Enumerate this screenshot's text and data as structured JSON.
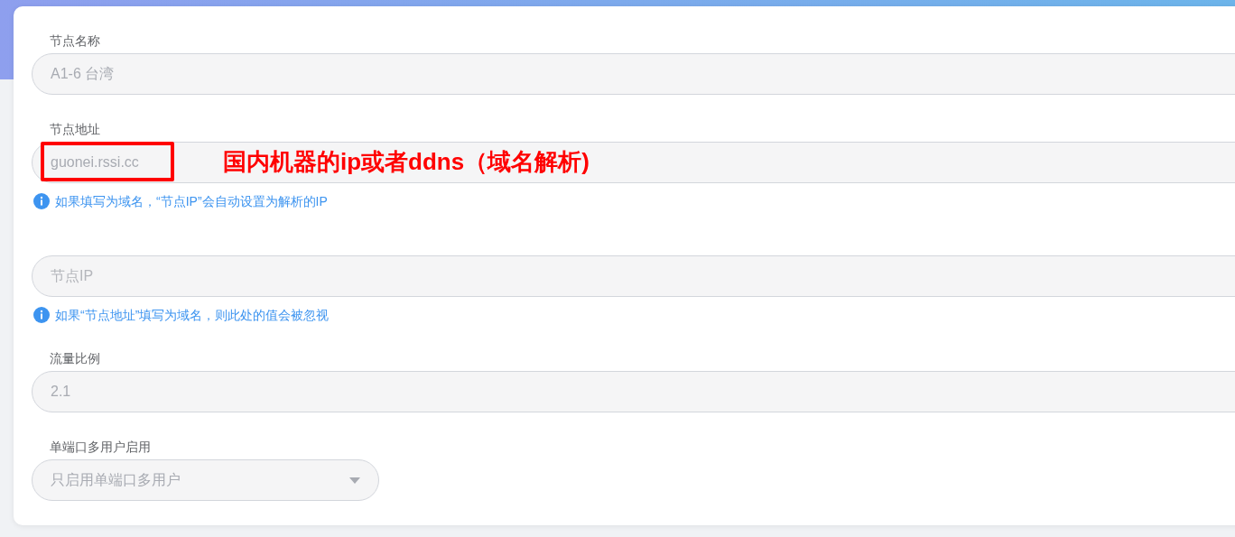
{
  "fields": [
    {
      "kind": "input",
      "label": "节点名称",
      "value": "A1-6 台湾"
    },
    {
      "kind": "input",
      "label": "节点地址",
      "value": "guonei.rssi.cc",
      "help": "如果填写为域名，“节点IP”会自动设置为解析的IP",
      "annotation": {
        "text": "国内机器的ip或者ddns（域名解析)",
        "boxed": true
      }
    },
    {
      "kind": "input",
      "placeholder": "节点IP",
      "help": "如果“节点地址”填写为域名，则此处的值会被忽视"
    },
    {
      "kind": "input",
      "label": "流量比例",
      "value": "2.1"
    },
    {
      "kind": "select",
      "label": "单端口多用户启用",
      "value": "只启用单端口多用户"
    }
  ]
}
